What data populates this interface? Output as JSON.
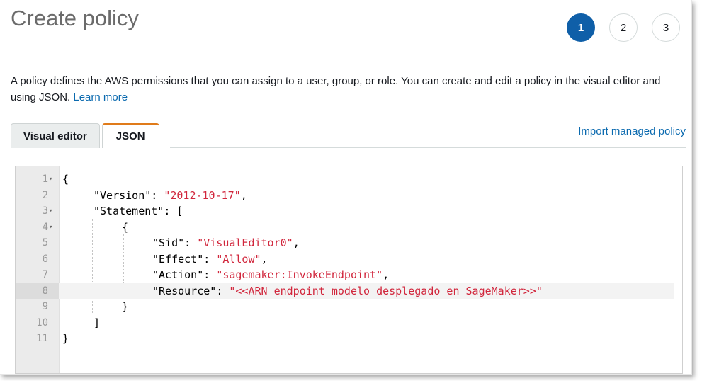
{
  "page": {
    "title": "Create policy",
    "steps": [
      "1",
      "2",
      "3"
    ],
    "active_step": "1",
    "description": "A policy defines the AWS permissions that you can assign to a user, group, or role. You can create and edit a policy in the visual editor and using JSON.",
    "learn_more": "Learn more"
  },
  "tabs": [
    {
      "label": "Visual editor",
      "active": false
    },
    {
      "label": "JSON",
      "active": true
    }
  ],
  "import_link": "Import managed policy",
  "editor": {
    "current_line": 8,
    "lines": [
      {
        "num": "1",
        "fold": true
      },
      {
        "num": "2",
        "fold": false
      },
      {
        "num": "3",
        "fold": true
      },
      {
        "num": "4",
        "fold": true
      },
      {
        "num": "5",
        "fold": false
      },
      {
        "num": "6",
        "fold": false
      },
      {
        "num": "7",
        "fold": false
      },
      {
        "num": "8",
        "fold": false
      },
      {
        "num": "9",
        "fold": false
      },
      {
        "num": "10",
        "fold": false
      },
      {
        "num": "11",
        "fold": false
      }
    ],
    "tokens": {
      "l1": "{",
      "l2_key": "\"Version\"",
      "l2_sep": ": ",
      "l2_val": "\"2012-10-17\"",
      "l2_end": ",",
      "l3_key": "\"Statement\"",
      "l3_rest": ": [",
      "l4": "{",
      "l5_key": "\"Sid\"",
      "l5_sep": ": ",
      "l5_val": "\"VisualEditor0\"",
      "l5_end": ",",
      "l6_key": "\"Effect\"",
      "l6_sep": ": ",
      "l6_val": "\"Allow\"",
      "l6_end": ",",
      "l7_key": "\"Action\"",
      "l7_sep": ": ",
      "l7_val": "\"sagemaker:InvokeEndpoint\"",
      "l7_end": ",",
      "l8_key": "\"Resource\"",
      "l8_sep": ": ",
      "l8_val": "\"<<ARN endpoint modelo desplegado en SageMaker>>\"",
      "l9": "}",
      "l10": "]",
      "l11": "}"
    }
  },
  "colors": {
    "accent": "#0f5fa8",
    "link": "#0b6aaf",
    "tab_active_border": "#e07b1a",
    "json_string": "#d1263c"
  }
}
